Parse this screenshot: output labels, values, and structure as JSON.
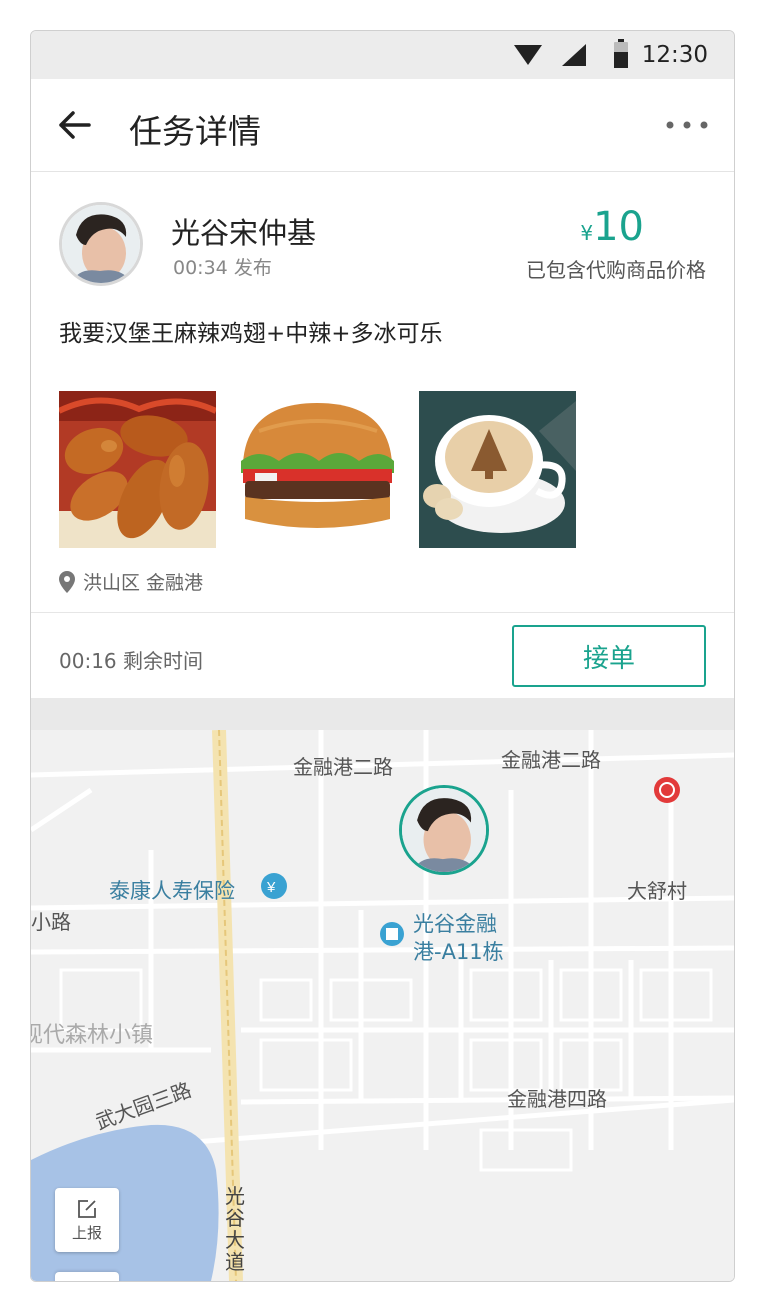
{
  "status_bar": {
    "time": "12:30",
    "icons": [
      "wifi-icon",
      "signal-icon",
      "battery-icon"
    ]
  },
  "app_bar": {
    "title": "任务详情",
    "back_icon": "arrow-left-icon",
    "more_icon": "more-horizontal-icon"
  },
  "task": {
    "user_name": "光谷宋仲基",
    "post_time": "00:34",
    "post_label": "发布",
    "price_currency": "¥",
    "price_amount": "10",
    "price_note": "已包含代购商品价格",
    "description": "我要汉堡王麻辣鸡翅+中辣+多冰可乐",
    "images": [
      "chicken-wings",
      "burger",
      "coffee"
    ],
    "location": "洪山区 金融港"
  },
  "footer": {
    "remaining_time": "00:16",
    "remaining_label": "剩余时间",
    "accept_label": "接单"
  },
  "map": {
    "labels": {
      "road1": "金融港二路",
      "road2": "金融港二路",
      "poi_insurance": "泰康人寿保险",
      "village": "大舒村",
      "road_left": "小路",
      "poi_building_line1": "光谷金融",
      "poi_building_line2": "港-A11栋",
      "town": "现代森林小镇",
      "road4": "金融港四路",
      "road_wuda": "武大园三路",
      "avenue": "光谷大道"
    },
    "report_label": "上报"
  },
  "colors": {
    "accent": "#1aa38e",
    "price": "#1aa38e"
  }
}
